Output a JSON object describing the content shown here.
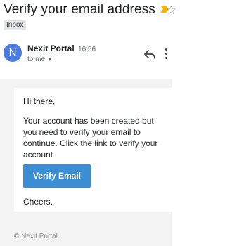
{
  "email": {
    "subject": "Verify your email address",
    "label": "Inbox",
    "sender_initial": "N",
    "sender_name": "Nexit Portal",
    "time": "16:56",
    "recipient": "to me"
  },
  "message": {
    "greeting": "Hi there,",
    "body": "Your account has been created but you need to verify your email to continue. Click the link to verify your account",
    "button_label": "Verify Email",
    "signoff": "Cheers."
  },
  "footer": {
    "text": "© Nexit Portal."
  },
  "colors": {
    "avatar": "#4c7ce2",
    "button": "#3b8ed3",
    "importance_marker": "#f4b400"
  },
  "icons": [
    "importance-marker-icon",
    "star-icon",
    "chevron-down-icon",
    "reply-icon",
    "more-vert-icon"
  ]
}
